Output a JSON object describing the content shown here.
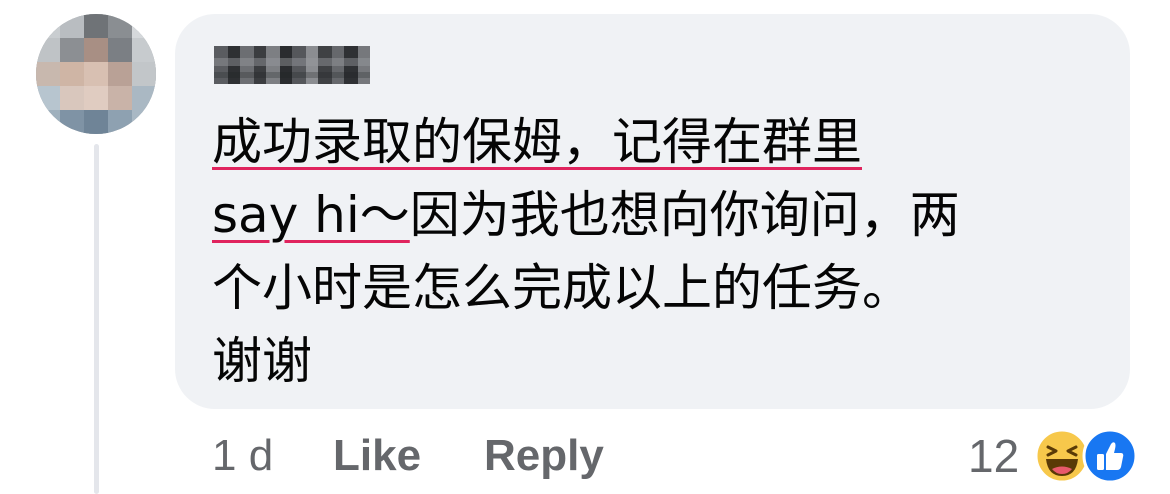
{
  "comment": {
    "lines": [
      "成功录取的保姆，记得在群里",
      "因为我也想向你询问，两",
      "个小时是怎么完成以上的任务。",
      "谢谢"
    ],
    "line1_underlined": "成功录取的保姆，记得在群里",
    "line2_underlined": "say hi～"
  },
  "actions": {
    "time": "1 d",
    "like_label": "Like",
    "reply_label": "Reply"
  },
  "reactions": {
    "count": "12",
    "icons": [
      "haha-icon",
      "like-thumb-icon"
    ],
    "like_color": "#1877f2",
    "haha_color": "#f7c84b"
  },
  "colors": {
    "bubble": "#f0f2f5",
    "text": "#050505",
    "meta": "#65676b",
    "spellcheck_underline": "#e0245e"
  }
}
